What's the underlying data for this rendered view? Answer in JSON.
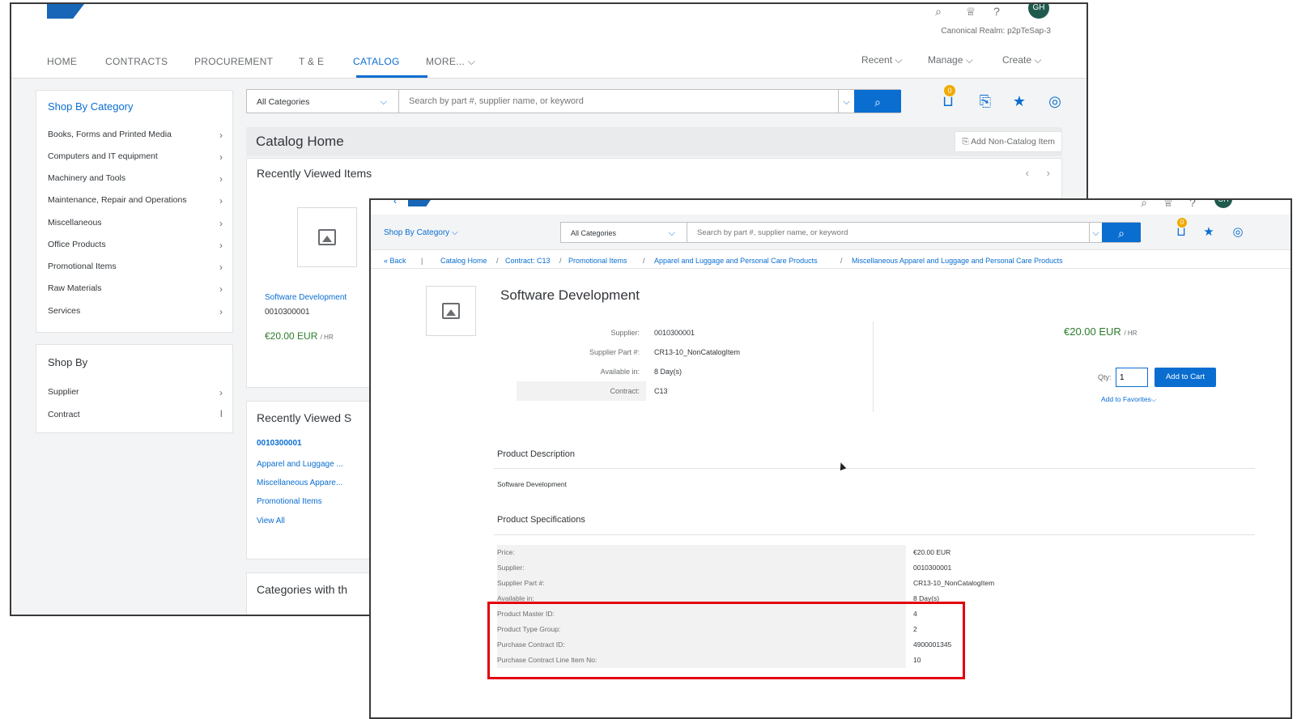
{
  "back": {
    "realm": "Canonical Realm: p2pTeSap-3",
    "nav": [
      "HOME",
      "CONTRACTS",
      "PROCUREMENT",
      "T & E",
      "CATALOG",
      "MORE..."
    ],
    "nav_right": [
      "Recent",
      "Manage",
      "Create"
    ],
    "avatar": "GH",
    "shop_by_category": {
      "title": "Shop By Category",
      "items": [
        "Books, Forms and Printed Media",
        "Computers and IT equipment",
        "Machinery and Tools",
        "Maintenance, Repair and Operations",
        "Miscellaneous",
        "Office Products",
        "Promotional Items",
        "Raw Materials",
        "Services"
      ]
    },
    "shop_by": {
      "title": "Shop By",
      "items": [
        "Supplier",
        "Contract"
      ]
    },
    "search": {
      "category": "All Categories",
      "placeholder": "Search by part #, supplier name, or keyword"
    },
    "cart_count": "0",
    "catalog_home": "Catalog Home",
    "add_non_catalog": "Add Non-Catalog Item",
    "recently_viewed_items": "Recently Viewed Items",
    "item": {
      "name": "Software Development",
      "code": "0010300001",
      "price": "€20.00 EUR",
      "unit": "/ HR"
    },
    "recently_viewed_suppliers": {
      "title": "Recently Viewed S",
      "code": "0010300001",
      "links": [
        "Apparel and Luggage ...",
        "Miscellaneous Appare...",
        "Promotional Items",
        "View All"
      ]
    },
    "categories_with": "Categories with th"
  },
  "front": {
    "avatar": "GH",
    "shop_by_category": "Shop By Category",
    "search": {
      "category": "All Categories",
      "placeholder": "Search by part #, supplier name, or keyword"
    },
    "cart_count": "0",
    "breadcrumb": {
      "back": "Back",
      "items": [
        "Catalog Home",
        "Contract: C13",
        "Promotional Items",
        "Apparel and Luggage and Personal Care Products",
        "Miscellaneous Apparel and Luggage and Personal Care Products"
      ]
    },
    "title": "Software Development",
    "details": [
      {
        "label": "Supplier:",
        "value": "0010300001"
      },
      {
        "label": "Supplier Part #:",
        "value": "CR13-10_NonCatalogItem"
      },
      {
        "label": "Available in:",
        "value": "8 Day(s)"
      },
      {
        "label": "Contract:",
        "value": "C13"
      }
    ],
    "price": "€20.00 EUR",
    "unit": "/ HR",
    "qty_label": "Qty:",
    "qty_value": "1",
    "add_to_cart": "Add to Cart",
    "add_to_favorites": "Add to Favorites",
    "product_description_title": "Product Description",
    "product_description": "Software Development",
    "product_specifications_title": "Product Specifications",
    "specs": [
      {
        "label": "Price:",
        "value": "€20.00 EUR"
      },
      {
        "label": "Supplier:",
        "value": "0010300001"
      },
      {
        "label": "Supplier Part #:",
        "value": "CR13-10_NonCatalogItem"
      },
      {
        "label": "Available in:",
        "value": "8 Day(s)"
      },
      {
        "label": "Product Master ID:",
        "value": "4"
      },
      {
        "label": "Product Type Group:",
        "value": "2"
      },
      {
        "label": "Purchase Contract ID:",
        "value": "4900001345"
      },
      {
        "label": "Purchase Contract Line Item No:",
        "value": "10"
      }
    ]
  },
  "colors": {
    "accent": "#0a6ed1",
    "price": "#2b7d2b",
    "highlight": "#e3000f",
    "badge": "#f0ab00"
  }
}
